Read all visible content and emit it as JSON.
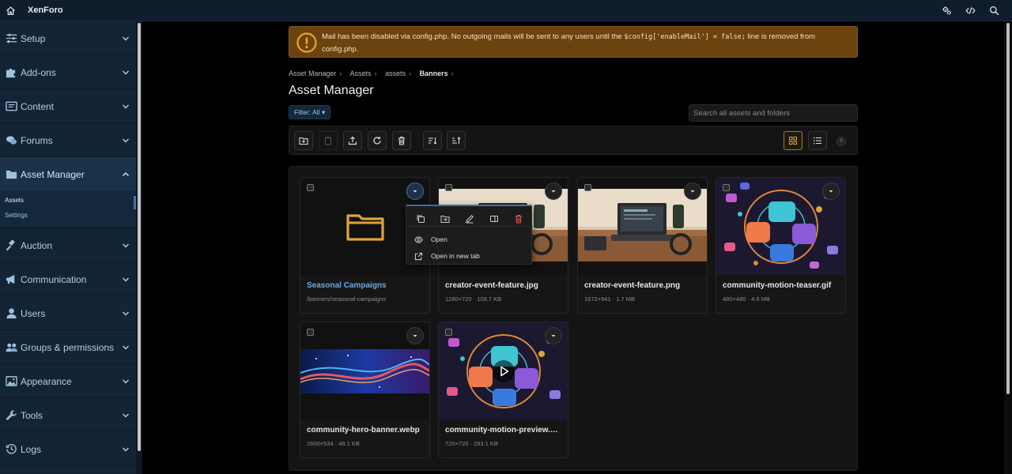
{
  "app": {
    "brand": "XenForo"
  },
  "topbar": {
    "icons": [
      "home-icon",
      "gears-icon",
      "code-icon",
      "search-icon"
    ]
  },
  "sidebar": {
    "items": [
      {
        "label": "Setup",
        "icon": "sliders-icon"
      },
      {
        "label": "Add-ons",
        "icon": "puzzle-icon"
      },
      {
        "label": "Content",
        "icon": "content-icon"
      },
      {
        "label": "Forums",
        "icon": "comments-icon"
      },
      {
        "label": "Asset Manager",
        "icon": "folder-icon",
        "expanded": true,
        "children": [
          "Assets",
          "Settings"
        ],
        "active_child": "Assets"
      },
      {
        "label": "Auction",
        "icon": "gavel-icon"
      },
      {
        "label": "Communication",
        "icon": "megaphone-icon"
      },
      {
        "label": "Users",
        "icon": "user-icon"
      },
      {
        "label": "Groups & permissions",
        "icon": "users-icon"
      },
      {
        "label": "Appearance",
        "icon": "image-icon"
      },
      {
        "label": "Tools",
        "icon": "wrench-icon"
      },
      {
        "label": "Logs",
        "icon": "history-icon"
      }
    ]
  },
  "notice": {
    "before": "Mail has been disabled via config.php. No outgoing mails will be sent to any users until the ",
    "code": "$config['enableMail'] = false;",
    "after": " line is removed from config.php.",
    "color": "#6b430f"
  },
  "breadcrumb": [
    "Asset Manager",
    "Assets",
    "assets",
    "Banners"
  ],
  "page_title": "Asset Manager",
  "filter": {
    "label": "Filter: All"
  },
  "search": {
    "placeholder": "Search all assets and folders"
  },
  "toolbar": {
    "buttons": [
      "new-folder-icon",
      "paste-icon",
      "upload-icon",
      "refresh-icon",
      "trash-icon",
      "sort-desc-icon",
      "sort-asc-icon"
    ],
    "views": [
      "grid-view-icon",
      "list-view-icon"
    ],
    "selected_count": "0"
  },
  "assets": [
    {
      "name": "Seasonal Campaigns",
      "meta": "/banners/seasonal-campaigns",
      "kind": "folder"
    },
    {
      "name": "creator-event-feature.jpg",
      "meta": "1280×720 · 109.7 KB",
      "kind": "desk"
    },
    {
      "name": "creator-event-feature.png",
      "meta": "1672×941 · 1.7 MB",
      "kind": "desk"
    },
    {
      "name": "community-motion-teaser.gif",
      "meta": "480×480 · 4.6 MB",
      "kind": "network"
    },
    {
      "name": "community-hero-banner.webp",
      "meta": "1600×534 · 48.1 KB",
      "kind": "wave"
    },
    {
      "name": "community-motion-preview.m...",
      "meta": "720×720 · 293.1 KB",
      "kind": "video"
    }
  ],
  "context_menu": {
    "actions": [
      "copy-icon",
      "move-icon",
      "rename-icon",
      "preview-icon",
      "delete-icon"
    ],
    "items": [
      {
        "label": "Open",
        "icon": "eye-icon"
      },
      {
        "label": "Open in new tab",
        "icon": "external-link-icon"
      }
    ]
  },
  "colors": {
    "accent": "#3b6fa3",
    "warning": "#f0a12b",
    "link": "#6fa8de",
    "delete": "#e05a5a"
  }
}
